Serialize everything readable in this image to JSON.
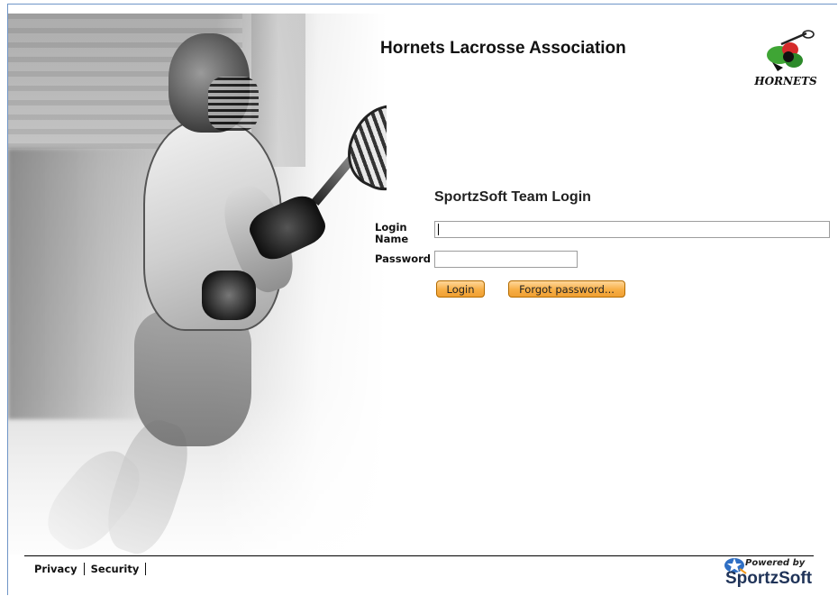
{
  "header": {
    "org_title": "Hornets Lacrosse Association",
    "logo_text": "HORNETS"
  },
  "login": {
    "heading": "SportzSoft Team Login",
    "login_name_label": "Login Name",
    "login_name_value": "",
    "password_label": "Password",
    "password_value": "",
    "login_button": "Login",
    "forgot_button": "Forgot password..."
  },
  "footer": {
    "privacy": "Privacy",
    "security": "Security",
    "powered_by": "Powered by",
    "brand": "SportzSoft"
  },
  "colors": {
    "button_orange": "#f7ae45",
    "frame_blue": "#6f95c7",
    "brand_navy": "#1f3358"
  },
  "icons": {
    "logo": "hornets-logo-icon",
    "powered": "sportzsoft-star-icon"
  }
}
